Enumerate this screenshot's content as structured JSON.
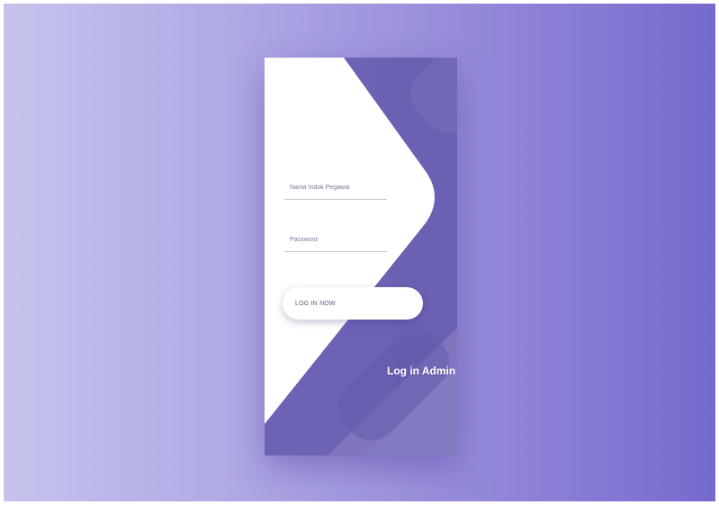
{
  "login_card": {
    "username": {
      "placeholder": "Nama Induk Pegawai",
      "value": ""
    },
    "password": {
      "placeholder": "Password",
      "value": ""
    },
    "login_button_label": "LOG IN NOW",
    "title": "Log in Admin"
  },
  "colors": {
    "background_start": "#c6c3ee",
    "background_end": "#756acd",
    "card_accent": "#6d63b5",
    "card_light": "#ffffff"
  }
}
